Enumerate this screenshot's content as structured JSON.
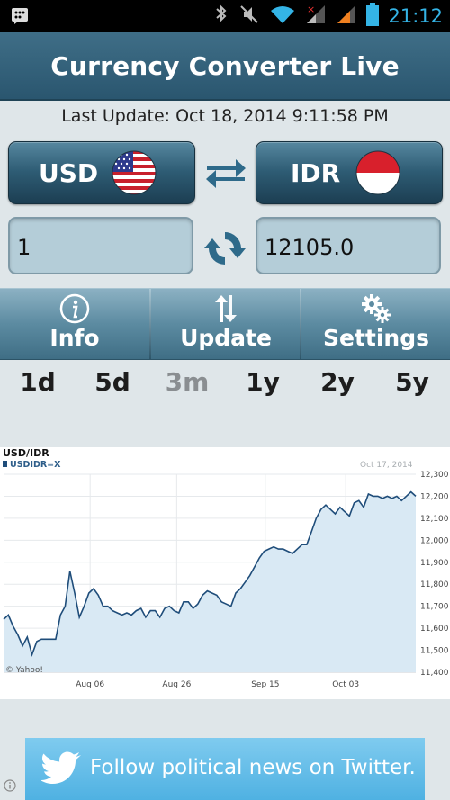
{
  "status_bar": {
    "time": "21:12",
    "icons": [
      "bbm-icon",
      "bluetooth-icon",
      "mute-icon",
      "wifi-icon",
      "signal-icon",
      "signal-icon",
      "battery-icon"
    ]
  },
  "app": {
    "title": "Currency Converter Live",
    "header_color": "#2f5d76"
  },
  "last_update": "Last Update: Oct 18, 2014 9:11:58 PM",
  "from_currency": {
    "code": "USD",
    "flag": "us-flag-icon"
  },
  "to_currency": {
    "code": "IDR",
    "flag": "indonesia-flag-icon"
  },
  "amount_from": "1",
  "amount_to": "12105.0",
  "toolbar": {
    "info_label": "Info",
    "update_label": "Update",
    "settings_label": "Settings"
  },
  "ranges": {
    "items": [
      "1d",
      "5d",
      "3m",
      "1y",
      "2y",
      "5y"
    ],
    "active": "3m"
  },
  "chart_data": {
    "type": "area",
    "title": "USD/IDR",
    "legend": "USDIDR=X",
    "date_label": "Oct 17, 2014",
    "credit": "© Yahoo!",
    "x_tick_labels": [
      "Aug 06",
      "Aug 26",
      "Sep 15",
      "Oct 03"
    ],
    "y_tick_labels": [
      "12,300",
      "12,200",
      "12,100",
      "12,000",
      "11,900",
      "11,800",
      "11,700",
      "11,600",
      "11,500",
      "11,400"
    ],
    "ylim": [
      11400,
      12300
    ],
    "grid": true,
    "series_color": "#1f4d7a",
    "fill_color": "#d9e9f4",
    "values": [
      11640,
      11660,
      11610,
      11570,
      11520,
      11560,
      11480,
      11540,
      11550,
      11550,
      11550,
      11550,
      11660,
      11700,
      11860,
      11760,
      11650,
      11700,
      11760,
      11780,
      11750,
      11700,
      11700,
      11680,
      11670,
      11660,
      11670,
      11660,
      11680,
      11690,
      11650,
      11680,
      11680,
      11650,
      11690,
      11700,
      11680,
      11670,
      11720,
      11720,
      11690,
      11710,
      11750,
      11770,
      11760,
      11750,
      11720,
      11710,
      11700,
      11760,
      11780,
      11810,
      11840,
      11880,
      11920,
      11950,
      11960,
      11970,
      11960,
      11960,
      11950,
      11940,
      11960,
      11980,
      11980,
      12040,
      12100,
      12140,
      12160,
      12140,
      12120,
      12150,
      12130,
      12110,
      12170,
      12180,
      12150,
      12210,
      12200,
      12200,
      12190,
      12200,
      12190,
      12200,
      12180,
      12200,
      12220,
      12200
    ]
  },
  "ad": {
    "text": "Follow political news on Twitter.",
    "icon": "twitter-bird-icon"
  }
}
